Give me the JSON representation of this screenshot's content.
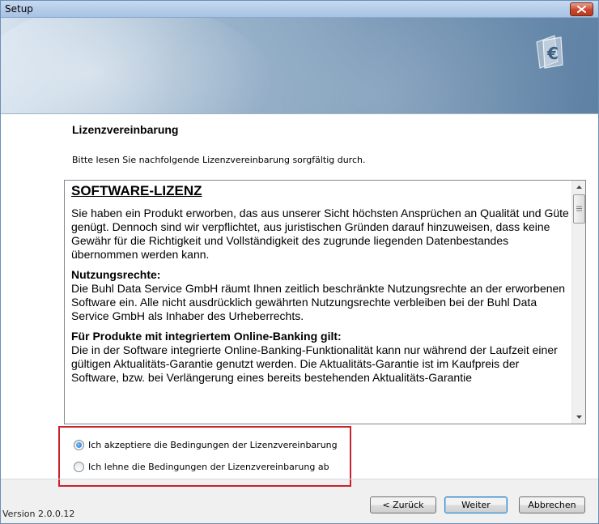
{
  "window": {
    "title": "Setup",
    "close_icon": "close-icon"
  },
  "banner": {
    "logo_icon": "euro-document-icon"
  },
  "page": {
    "heading": "Lizenzvereinbarung",
    "subtitle": "Bitte lesen Sie nachfolgende Lizenzvereinbarung sorgfältig durch."
  },
  "license": {
    "title": "SOFTWARE-LIZENZ",
    "para1": "Sie haben ein Produkt erworben, das aus unserer Sicht höchsten Ansprüchen an Qualität und Güte genügt. Dennoch sind wir verpflichtet, aus juristischen Gründen darauf hinzuweisen, dass keine Gewähr für die Richtigkeit und Vollständigkeit des zugrunde liegenden Datenbestandes übernommen werden kann.",
    "section1_title": "Nutzungsrechte:",
    "section1_body": "Die Buhl Data Service GmbH räumt Ihnen zeitlich beschränkte Nutzungsrechte an der erworbenen Software ein. Alle nicht ausdrücklich gewährten Nutzungsrechte verbleiben bei der Buhl Data Service GmbH als Inhaber des Urheberrechts.",
    "section2_title": "Für Produkte mit integriertem Online-Banking gilt:",
    "section2_body": "Die in der Software integrierte Online-Banking-Funktionalität kann nur während der Laufzeit einer gültigen Aktualitäts-Garantie genutzt werden. Die Aktualitäts-Garantie ist im Kaufpreis der Software, bzw. bei Verlängerung eines bereits bestehenden Aktualitäts-Garantie"
  },
  "options": {
    "accept_label": "Ich akzeptiere die Bedingungen der Lizenzvereinbarung",
    "accept_checked": true,
    "decline_label": "Ich lehne die Bedingungen der Lizenzvereinbarung ab",
    "decline_checked": false
  },
  "footer": {
    "version": "Version 2.0.0.12",
    "back_label": "< Zurück",
    "next_label": "Weiter",
    "cancel_label": "Abbrechen"
  },
  "colors": {
    "highlight_border": "#c8232c",
    "default_button_border": "#3c7fb1"
  }
}
